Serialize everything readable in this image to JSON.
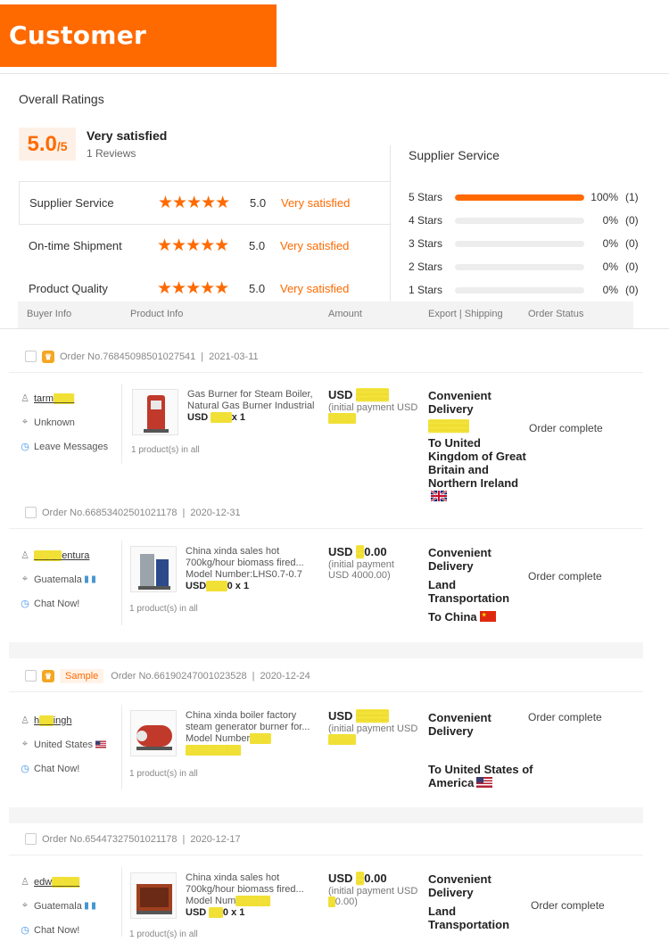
{
  "banner": {
    "title": "Customer Evaluation"
  },
  "overall": {
    "title": "Overall Ratings",
    "score": "5.0",
    "score_suffix": "/5",
    "label": "Very satisfied",
    "reviews": "1 Reviews"
  },
  "criteria": [
    {
      "label": "Supplier Service",
      "stars": "★★★★★",
      "value": "5.0",
      "text": "Very satisfied"
    },
    {
      "label": "On-time Shipment",
      "stars": "★★★★★",
      "value": "5.0",
      "text": "Very satisfied"
    },
    {
      "label": "Product Quality",
      "stars": "★★★★★",
      "value": "5.0",
      "text": "Very satisfied"
    }
  ],
  "supplier_service": {
    "title": "Supplier Service",
    "rows": [
      {
        "label": "5 Stars",
        "pct": "100%",
        "count": "(1)",
        "fill": 1.0
      },
      {
        "label": "4 Stars",
        "pct": "0%",
        "count": "(0)",
        "fill": 0
      },
      {
        "label": "3 Stars",
        "pct": "0%",
        "count": "(0)",
        "fill": 0
      },
      {
        "label": "2 Stars",
        "pct": "0%",
        "count": "(0)",
        "fill": 0
      },
      {
        "label": "1 Stars",
        "pct": "0%",
        "count": "(0)",
        "fill": 0
      }
    ]
  },
  "table_header": {
    "buyer": "Buyer Info",
    "product": "Product Info",
    "amount": "Amount",
    "export": "Export | Shipping",
    "status": "Order Status"
  },
  "orders": [
    {
      "order_no": "Order No.76845098501027541",
      "date": "2021-03-11",
      "buyer": "tarm",
      "location": "Unknown",
      "action": "Leave Messages",
      "product_desc": "Gas Burner for Steam Boiler, Natural Gas Burner Industrial",
      "product_price": "USD",
      "product_qty": "x 1",
      "product_count": "1 product(s) in all",
      "amount": "USD",
      "amount_sub": "(initial payment USD",
      "ship1": "Convenient Delivery",
      "ship3": "To United Kingdom of Great Britain and Northern Ireland",
      "status": "Order complete"
    },
    {
      "order_no": "Order No.66853402501021178",
      "date": "2020-12-31",
      "buyer": "entura",
      "location": "Guatemala",
      "action": "Chat Now!",
      "product_desc": "China xinda sales hot 700kg/hour biomass fired...",
      "product_model": "Model Number:LHS0.7-0.7",
      "product_price": "USD",
      "product_qty": "0 x 1",
      "product_count": "1 product(s) in all",
      "amount": "USD",
      "amount_tail": "0.00",
      "amount_sub": "(initial payment USD 4000.00)",
      "ship1": "Convenient Delivery",
      "ship2": "Land Transportation",
      "ship3": "To China",
      "status": "Order complete"
    },
    {
      "order_no": "Order No.66190247001023528",
      "date": "2020-12-24",
      "tag": "Sample",
      "buyer": "h",
      "buyer_tail": "ingh",
      "location": "United States",
      "action": "Chat Now!",
      "product_desc": "China xinda boiler factory steam generator burner for...",
      "product_model": "Model Number",
      "product_count": "1 product(s) in all",
      "amount": "USD",
      "amount_sub": "(initial payment USD",
      "ship1": "Convenient Delivery",
      "ship3": "To United States of America",
      "status": "Order complete"
    },
    {
      "order_no": "Order No.65447327501021178",
      "date": "2020-12-17",
      "buyer": "edw",
      "location": "Guatemala",
      "action": "Chat Now!",
      "product_desc": "China xinda sales hot 700kg/hour biomass fired...",
      "product_model": "Model Num",
      "product_price": "USD",
      "product_qty": "0 x 1",
      "product_count": "1 product(s) in all",
      "amount": "USD",
      "amount_tail": "0.00",
      "amount_sub": "(initial payment USD",
      "amount_sub2": "0.00)",
      "ship1": "Convenient Delivery",
      "ship2": "Land Transportation",
      "status": "Order complete"
    }
  ],
  "colors": {
    "accent": "#ff6a00",
    "highlight": "#f7e94a"
  }
}
